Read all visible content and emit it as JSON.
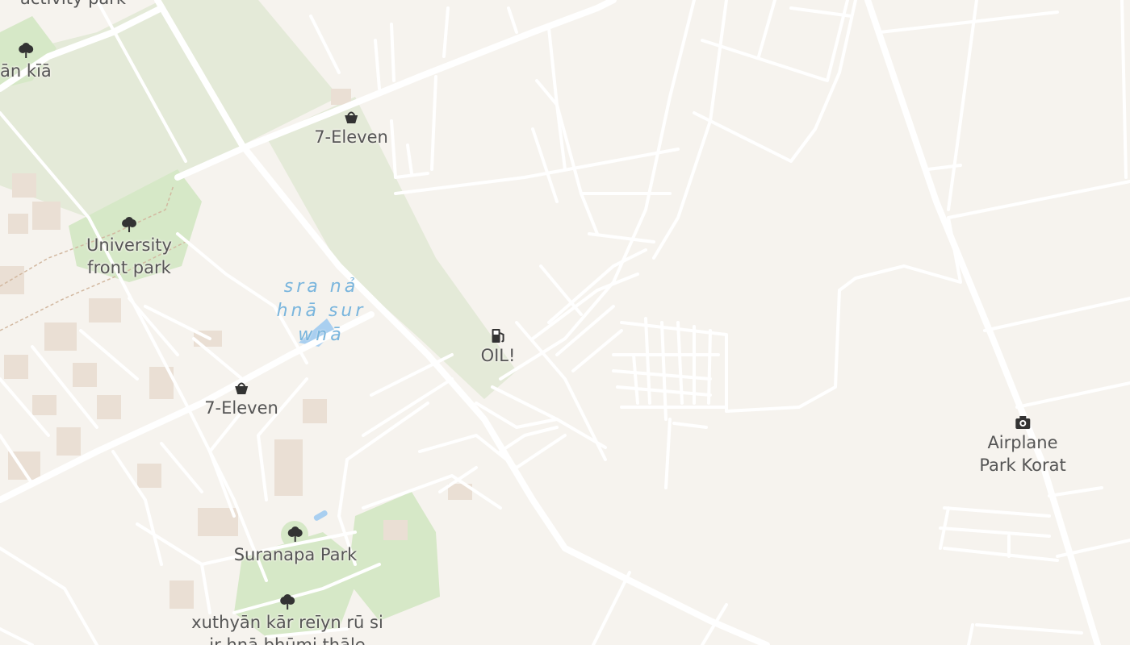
{
  "map": {
    "colors": {
      "background": "#f6f3ee",
      "park": "#e4ead8",
      "park_green": "#d6e8c7",
      "road": "#ffffff",
      "building": "#eadfd4",
      "water": "#a9cff0",
      "label": "#555555",
      "water_label": "#79b5dd"
    },
    "labels": {
      "activity_park": "activity park",
      "lan_kia": "lān kīā",
      "seven_eleven_top": "7-Eleven",
      "university_park_line1": "University",
      "university_park_line2": "front park",
      "water_line1": "sra nả",
      "water_line2": "hnā sur",
      "water_line3": "wnā",
      "oil": "OIL!",
      "seven_eleven_mid": "7-Eleven",
      "airplane_park_line1": "Airplane",
      "airplane_park_line2": "Park Korat",
      "suranapa_park": "Suranapa Park",
      "xuthyan_line1": "xuthyān kār reīyn rū si",
      "xuthyan_line2": "ir hnā bhūmi thāle"
    },
    "icons": {
      "tree": "tree-icon",
      "basket": "basket-icon",
      "fuel": "fuel-pump-icon",
      "camera": "camera-icon"
    }
  }
}
